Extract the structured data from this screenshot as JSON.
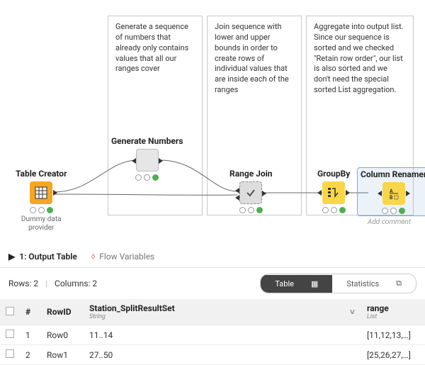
{
  "annotations": {
    "a1": "Generate a sequence of numbers that already only contains values that all our ranges cover",
    "a2": "Join sequence with lower and upper bounds in order to create rows of individual values that are inside each of the ranges",
    "a3": "Aggregate into output list. Since our sequence is sorted and we checked \"Retain row order\", our list is also sorted and we don't need the special sorted List aggregation."
  },
  "nodes": {
    "tableCreator": {
      "label": "Table Creator",
      "caption": "Dummy data\nprovider"
    },
    "generateNumbers": {
      "label": "Generate Numbers"
    },
    "rangeJoin": {
      "label": "Range Join"
    },
    "groupBy": {
      "label": "GroupBy"
    },
    "columnRenamer": {
      "label": "Column Renamer",
      "addComment": "Add comment"
    }
  },
  "tabs": {
    "output": "1: Output Table",
    "flow": "Flow Variables"
  },
  "meta": {
    "rows": "Rows: 2",
    "cols": "Columns: 2",
    "toggleOn": "Table",
    "toggleOff": "Statistics"
  },
  "table": {
    "headers": {
      "num": "#",
      "rowId": "RowID",
      "col1": "Station_SplitResultSet",
      "col1_type": "String",
      "col2": "range",
      "col2_type": "List"
    },
    "rows": [
      {
        "num": "1",
        "rowId": "Row0",
        "c1": "11..14",
        "c2": "[11,12,13,…]"
      },
      {
        "num": "2",
        "rowId": "Row1",
        "c1": "27..50",
        "c2": "[25,26,27,…]"
      }
    ]
  }
}
